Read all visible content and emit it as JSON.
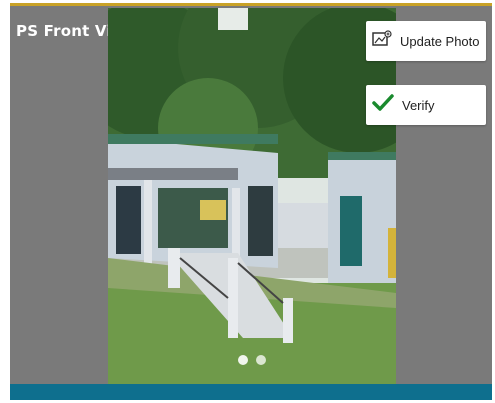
{
  "header": {
    "title": "PS Front View"
  },
  "actions": {
    "update_photo": {
      "label": "Update Photo",
      "icon": "image-icon"
    },
    "verify": {
      "label": "Verify",
      "icon": "checkmark-icon",
      "icon_color": "#1a8a2e"
    }
  },
  "carousel": {
    "page_count": 2,
    "active_index": 0
  },
  "colors": {
    "frame": "#7a7a7a",
    "accent_top": "#c9a227",
    "bottom_bar": "#0e6f8e"
  }
}
